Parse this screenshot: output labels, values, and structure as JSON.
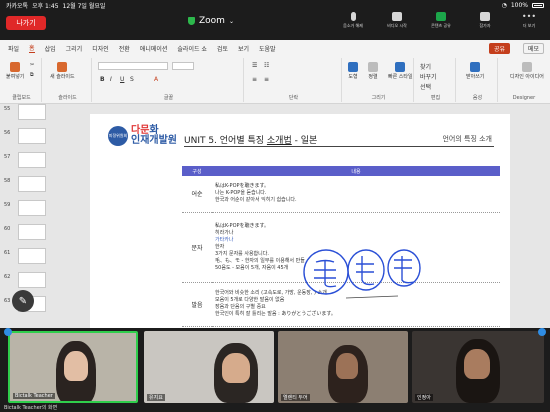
{
  "status_bar": {
    "carrier": "카카오톡",
    "time": "오후 1:45",
    "date": "12월 7일 월요일",
    "battery": "100%"
  },
  "zoom": {
    "leave_label": "나가기",
    "title": "Zoom",
    "tools": [
      {
        "label": "음소거 해제",
        "icon": "mic-icon"
      },
      {
        "label": "비디오 시작",
        "icon": "video-icon"
      },
      {
        "label": "콘텐츠 공유",
        "icon": "share-screen-icon"
      },
      {
        "label": "참가자",
        "icon": "participants-icon"
      },
      {
        "label": "더 보기",
        "icon": "more-icon"
      }
    ]
  },
  "ribbon": {
    "tabs": [
      "파일",
      "홈",
      "삽입",
      "그리기",
      "디자인",
      "전환",
      "애니메이션",
      "슬라이드 쇼",
      "검토",
      "보기",
      "도움말"
    ],
    "active_tab": "홈",
    "share_label": "공유",
    "comment_label": "메모",
    "groups": [
      "클립보드",
      "슬라이드",
      "글꼴",
      "단락",
      "그리기",
      "편집",
      "음성",
      "Designer"
    ],
    "buttons": {
      "paste": "붙여넣기",
      "new_slide": "새 슬라이드",
      "shapes": "도형",
      "arrange": "정렬",
      "quick_styles": "빠른 스타일",
      "find": "찾기",
      "replace": "바꾸기",
      "select": "선택",
      "dictate": "받아쓰기",
      "designer": "디자인 아이디어"
    }
  },
  "thumbs": [
    "55",
    "56",
    "57",
    "58",
    "59",
    "60",
    "61",
    "62",
    "63"
  ],
  "slide": {
    "logo_circle": "피정위원회",
    "logo_line1_a": "다문",
    "logo_line1_b": "화",
    "logo_line2": "인재개발원",
    "unit_prefix": "UNIT 5. 언어별 특징 ",
    "unit_underlined": "소개법",
    "unit_suffix": " - 일본",
    "subtitle": "언어의 특징 소개",
    "table_headers": [
      "구성",
      "내용"
    ],
    "rows": [
      {
        "category": "어순",
        "lines": [
          "私はK-POPを聴きます。",
          "나는 K-POP을 듣습니다.",
          "한국과 어순이 같아서 익히기 쉽습니다."
        ]
      },
      {
        "category": "문자",
        "lines": [
          "私はK-POPを聴きます。",
          "히라가나",
          "가타카나",
          "한자",
          "3가지 문자를 사용합니다.",
          "毛、も、モ - 한자의 일부를 이용해서 만들",
          "50음도 - 모음이 5개, 자음이 45개"
        ]
      },
      {
        "category": "발음",
        "lines": [
          "한국어와 비슷한 소리 (고속도로, 가방, 운동장, ) 소개",
          "모음이 5개로 다양한 발음이 없음",
          "장음과 단음의 구별 중요",
          "한국인이 특히 잘 틀리는 발음 : ありがとうございます。"
        ]
      }
    ]
  },
  "videos": [
    {
      "name": "Bictalk Teacher",
      "active": true
    },
    {
      "name": "유지요",
      "active": false
    },
    {
      "name": "엘렌티 두어",
      "active": false
    },
    {
      "name": "인정아",
      "active": false
    }
  ],
  "bottom_label": "Bictalk Teacher의 화면"
}
